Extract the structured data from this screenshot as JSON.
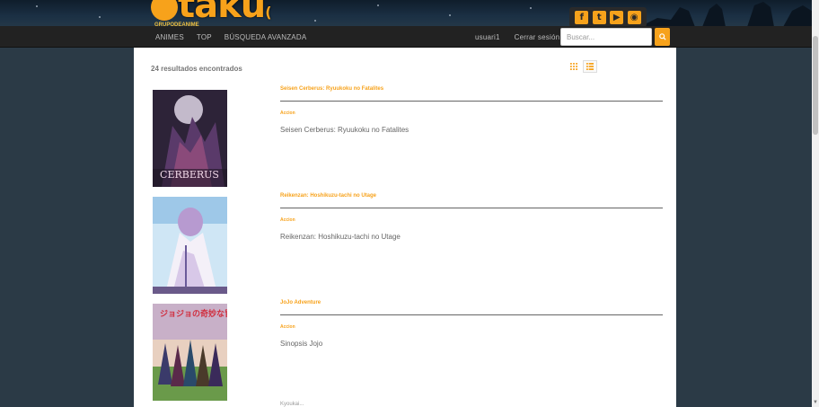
{
  "header": {
    "logo_text": "taku",
    "logo_sub": "GRUPODEANIME",
    "social": [
      {
        "icon": "facebook-icon",
        "glyph": "f"
      },
      {
        "icon": "twitter-icon",
        "glyph": "t"
      },
      {
        "icon": "youtube-icon",
        "glyph": "▶"
      },
      {
        "icon": "rss-icon",
        "glyph": "◉"
      }
    ]
  },
  "nav": {
    "animes": "ANIMES",
    "top": "TOP",
    "advanced_search": "BÚSQUEDA AVANZADA",
    "user": "usuari1",
    "logout": "Cerrar sesión",
    "search_placeholder": "Buscar...",
    "search_icon": "search-icon"
  },
  "results": {
    "count_label": "24 resultados encontrados",
    "views": [
      "grid-view-icon",
      "list-view-icon"
    ],
    "active_view": "list"
  },
  "entries": [
    {
      "title": "Seisen Cerberus: Ryuukoku no Fatalites",
      "genre": "Accion",
      "synopsis": "Seisen Cerberus: Ryuukoku no Fatalites",
      "poster_text": "CERBERUS",
      "colors": [
        "#3a2a4a",
        "#8a5a9a",
        "#c0546a"
      ]
    },
    {
      "title": "Reikenzan: Hoshikuzu-tachi no Utage",
      "genre": "Accion",
      "synopsis": "Reikenzan: Hoshikuzu-tachi no Utage",
      "poster_text": "",
      "colors": [
        "#b8d8f0",
        "#e8e0f0",
        "#8a6aa0"
      ]
    },
    {
      "title": "JoJo Adventure",
      "genre": "Accion",
      "synopsis": "Sinopsis Jojo",
      "poster_text": "ジョジョの奇妙な冒険",
      "colors": [
        "#d04050",
        "#6a8a3a",
        "#3a4a7a"
      ]
    }
  ],
  "partial_next": "Kyoukai..."
}
